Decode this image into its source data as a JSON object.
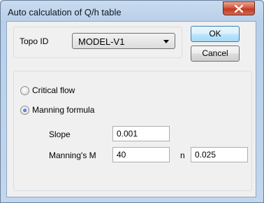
{
  "window": {
    "title": "Auto calculation of Q/h table"
  },
  "topo": {
    "label": "Topo ID",
    "selected": "MODEL-V1"
  },
  "buttons": {
    "ok": "OK",
    "cancel": "Cancel"
  },
  "method": {
    "critical_label": "Critical flow",
    "manning_label": "Manning formula",
    "selected": "manning"
  },
  "params": {
    "slope_label": "Slope",
    "slope_value": "0.001",
    "manning_m_label": "Manning's M",
    "manning_m_value": "40",
    "n_label": "n",
    "n_value": "0.025"
  },
  "icons": {
    "close": "close-icon",
    "dropdown": "chevron-down-icon"
  }
}
